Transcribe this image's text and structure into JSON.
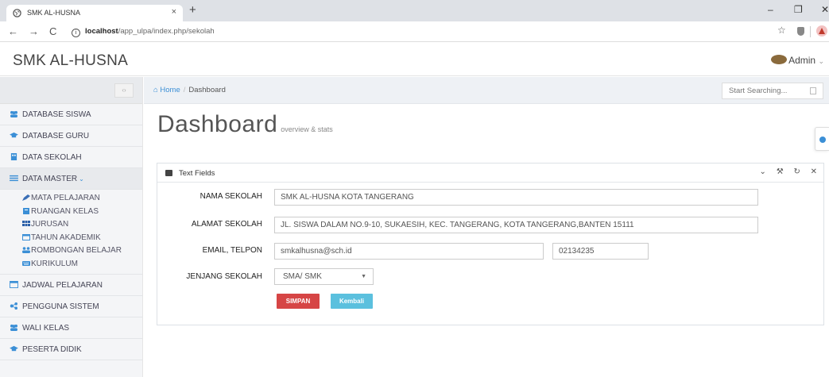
{
  "browser": {
    "tab_title": "SMK AL-HUSNA",
    "tab_close": "×",
    "new_tab": "+",
    "url_host": "localhost",
    "url_path": "/app_ulpa/index.php/sekolah",
    "window_controls": [
      "–",
      "❐",
      "✕"
    ]
  },
  "header": {
    "brand": "SMK AL-HUSNA",
    "user": "Admin"
  },
  "sidebar": {
    "items": [
      {
        "label": "DATABASE SISWA",
        "icon": "users-icon",
        "color": "#3b8fd6"
      },
      {
        "label": "DATABASE GURU",
        "icon": "graduation-cap-icon",
        "color": "#3b8fd6"
      },
      {
        "label": "DATA SEKOLAH",
        "icon": "building-icon",
        "color": "#3b8fd6"
      },
      {
        "label": "DATA MASTER",
        "icon": "list-icon",
        "color": "#3b8fd6"
      }
    ],
    "submenu": [
      {
        "label": "MATA PELAJARAN",
        "icon": "pencil-icon"
      },
      {
        "label": "RUANGAN KELAS",
        "icon": "building-icon"
      },
      {
        "label": "JURUSAN",
        "icon": "grid-icon"
      },
      {
        "label": "TAHUN AKADEMIK",
        "icon": "calendar-icon"
      },
      {
        "label": "ROMBONGAN BELAJAR",
        "icon": "users-icon"
      },
      {
        "label": "KURIKULUM",
        "icon": "keyboard-icon"
      }
    ],
    "bottom_items": [
      {
        "label": "JADWAL PELAJARAN",
        "icon": "calendar-icon"
      },
      {
        "label": "PENGGUNA SISTEM",
        "icon": "share-icon"
      },
      {
        "label": "WALI KELAS",
        "icon": "users-icon"
      },
      {
        "label": "PESERTA DIDIK",
        "icon": "graduation-cap-icon"
      }
    ]
  },
  "breadcrumb": {
    "home": "Home",
    "current": "Dashboard"
  },
  "search": {
    "placeholder": "Start Searching..."
  },
  "page": {
    "title": "Dashboard",
    "subtitle": "overview & stats"
  },
  "portlet": {
    "title": "Text Fields",
    "tools": [
      "⌄",
      "⚒",
      "↻",
      "✕"
    ]
  },
  "form": {
    "nama_label": "NAMA SEKOLAH",
    "nama_value": "SMK AL-HUSNA KOTA TANGERANG",
    "alamat_label": "ALAMAT SEKOLAH",
    "alamat_value": "JL. SISWA DALAM NO.9-10, SUKAESIH, KEC. TANGERANG, KOTA TANGERANG,BANTEN 15111",
    "email_label": "EMAIL, TELPON",
    "email_value": "smkalhusna@sch.id",
    "telpon_value": "02134235",
    "jenjang_label": "JENJANG SEKOLAH",
    "jenjang_value": "SMA/ SMK",
    "simpan_label": "SIMPAN",
    "kembali_label": "Kembali"
  },
  "colors": {
    "accent": "#3b8fd6",
    "danger": "#d64545",
    "info": "#5bc0de"
  }
}
